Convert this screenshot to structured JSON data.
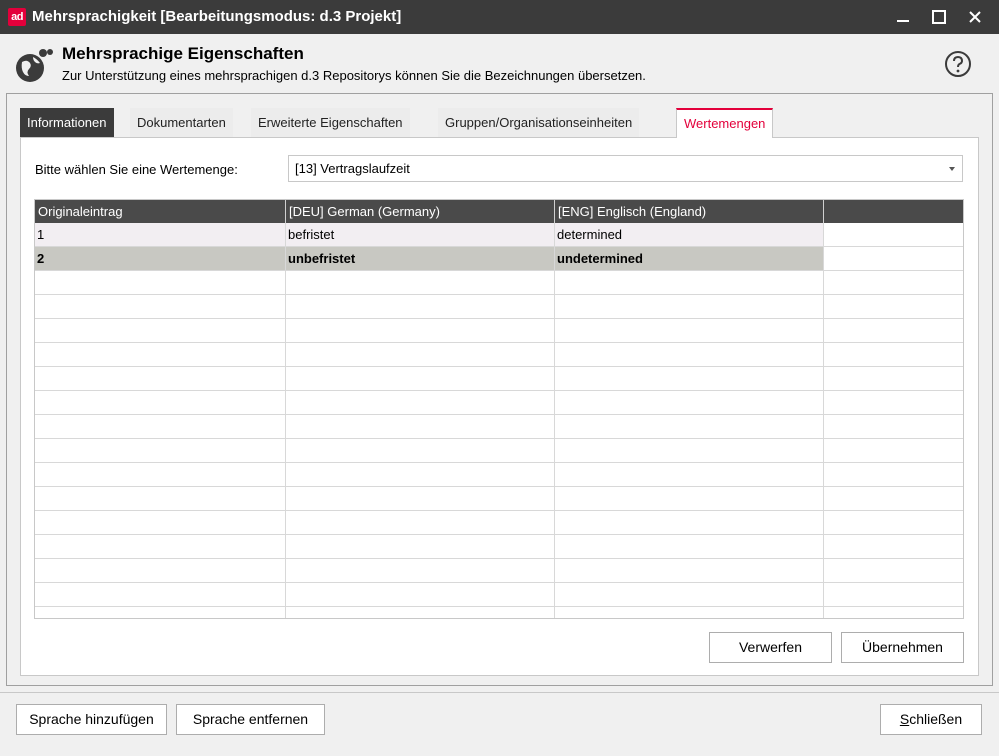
{
  "window": {
    "logo_text": "ad",
    "title": "Mehrsprachigkeit  [Bearbeitungsmodus: d.3 Projekt]",
    "accent_color": "#e3003b",
    "titlebar_color": "#3b3b3b"
  },
  "header": {
    "icon": "globe-icon",
    "title": "Mehrsprachige Eigenschaften",
    "subtitle": "Zur Unterstützung eines mehrsprachigen d.3 Repositorys können Sie die Bezeichnungen übersetzen.",
    "help_icon": "help-icon"
  },
  "tabs": [
    {
      "label": "Informationen"
    },
    {
      "label": "Dokumentarten"
    },
    {
      "label": "Erweiterte Eigenschaften"
    },
    {
      "label": "Gruppen/Organisationseinheiten"
    },
    {
      "label": "Wertemengen"
    }
  ],
  "selected_tab": "Wertemengen",
  "valueset": {
    "label": "Bitte wählen Sie eine Wertemenge:",
    "selected": "[13] Vertragslaufzeit"
  },
  "table": {
    "columns": [
      "Originaleintrag",
      "[DEU] German (Germany)",
      "[ENG] Englisch (England)",
      ""
    ],
    "rows": [
      [
        "1",
        "befristet",
        "determined"
      ],
      [
        "2",
        "unbefristet",
        "undetermined"
      ]
    ]
  },
  "panel_buttons": {
    "discard": "Verwerfen",
    "apply": "Übernehmen"
  },
  "footer_buttons": {
    "add_language": "Sprache hinzufügen",
    "remove_language": "Sprache entfernen",
    "close": "Schließen"
  }
}
